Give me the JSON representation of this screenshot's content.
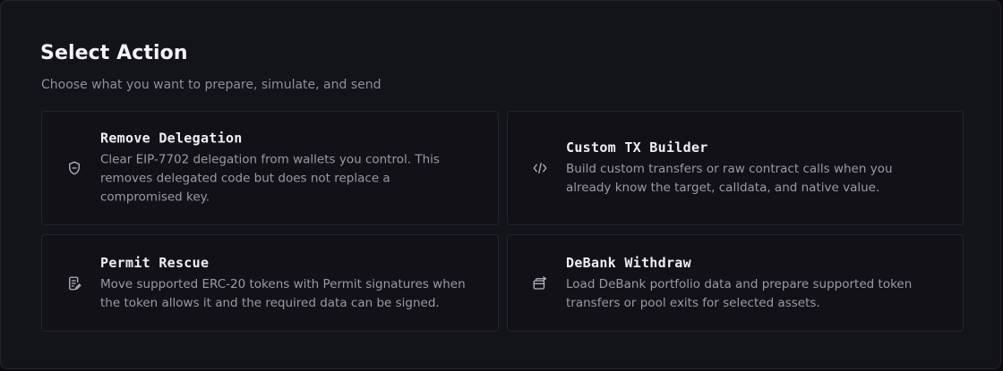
{
  "header": {
    "title": "Select Action",
    "subtitle": "Choose what you want to prepare, simulate, and send"
  },
  "actions": [
    {
      "icon": "shield-icon",
      "title": "Remove Delegation",
      "description": "Clear EIP-7702 delegation from wallets you control. This removes delegated code but does not replace a compromised key."
    },
    {
      "icon": "code-icon",
      "title": "Custom TX Builder",
      "description": "Build custom transfers or raw contract calls when you already know the target, calldata, and native value."
    },
    {
      "icon": "document-edit-icon",
      "title": "Permit Rescue",
      "description": "Move supported ERC-20 tokens with Permit signatures when the token allows it and the required data can be signed."
    },
    {
      "icon": "wallet-export-icon",
      "title": "DeBank Withdraw",
      "description": "Load DeBank portfolio data and prepare supported token transfers or pool exits for selected assets."
    }
  ]
}
